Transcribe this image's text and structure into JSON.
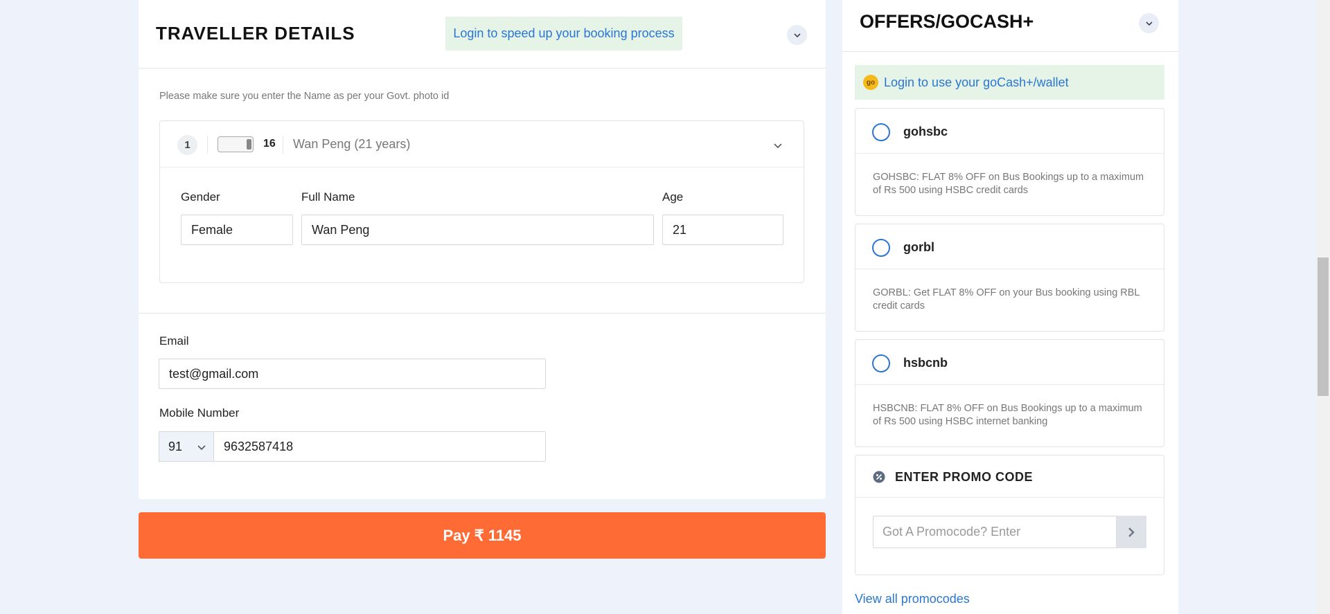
{
  "traveller": {
    "title": "TRAVELLER DETAILS",
    "login_banner": "Login to speed up your booking process",
    "note": "Please make sure you enter the Name as per your Govt. photo id",
    "passenger": {
      "index": "1",
      "seat": "16",
      "summary": "Wan Peng (21 years)",
      "gender_label": "Gender",
      "gender_value": "Female",
      "name_label": "Full Name",
      "name_value": "Wan Peng",
      "age_label": "Age",
      "age_value": "21"
    }
  },
  "contact": {
    "email_label": "Email",
    "email_value": "test@gmail.com",
    "mobile_label": "Mobile Number",
    "country_code": "91",
    "mobile_value": "9632587418"
  },
  "pay_button": "Pay ₹ 1145",
  "offers": {
    "title": "OFFERS/GOCASH+",
    "gocash_badge": "go",
    "gocash_text": "Login to use your goCash+/wallet",
    "items": [
      {
        "code": "gohsbc",
        "desc": "GOHSBC: FLAT 8% OFF on Bus Bookings up to a maximum of Rs 500 using HSBC credit cards"
      },
      {
        "code": "gorbl",
        "desc": "GORBL: Get FLAT 8% OFF on your Bus booking using RBL credit cards"
      },
      {
        "code": "hsbcnb",
        "desc": "HSBCNB: FLAT 8% OFF on Bus Bookings up to a maximum of Rs 500 using HSBC internet banking"
      }
    ],
    "promo_title": "ENTER PROMO CODE",
    "promo_placeholder": "Got A Promocode? Enter",
    "view_all": "View all promocodes"
  },
  "colors": {
    "accent_blue": "#2a76d2",
    "pay_orange": "#ff6b35",
    "banner_green": "#e5f4e6",
    "page_bg": "#eef3fb"
  }
}
